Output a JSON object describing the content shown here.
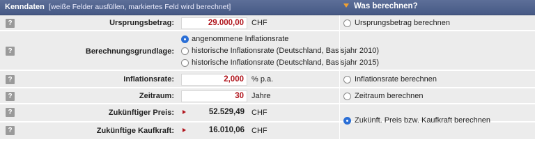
{
  "header": {
    "title": "Kenndaten",
    "subtitle": "[weiße Felder ausfüllen, markiertes Feld wird berechnet]",
    "right_title": "Was berechnen?"
  },
  "help_label": "?",
  "rows": {
    "ursprungsbetrag": {
      "label": "Ursprungsbetrag:",
      "value": "29.000,00",
      "unit": "CHF",
      "calc_option": "Ursprungsbetrag berechnen"
    },
    "berechnungsgrundlage": {
      "label": "Berechnungsgrundlage:",
      "options": [
        "angenommene Inflationsrate",
        "historische Inflationsrate (Deutschland, Basisjahr 2010)",
        "historische Inflationsrate (Deutschland, Basisjahr 2015)"
      ],
      "selected": "angenommene Inflationsrate"
    },
    "inflationsrate": {
      "label": "Inflationsrate:",
      "value": "2,000",
      "unit": "% p.a.",
      "calc_option": "Inflationsrate berechnen"
    },
    "zeitraum": {
      "label": "Zeitraum:",
      "value": "30",
      "unit": "Jahre",
      "calc_option": "Zeitraum berechnen"
    },
    "zukuenftiger_preis": {
      "label": "Zukünftiger Preis:",
      "value": "52.529,49",
      "unit": "CHF"
    },
    "zukuenftige_kaufkraft": {
      "label": "Zukünftige Kaufkraft:",
      "value": "16.010,06",
      "unit": "CHF"
    },
    "calc_selected": "Zukünft. Preis bzw. Kaufkraft berechnen"
  },
  "colors": {
    "header_bg": "#4f6290",
    "accent_orange": "#f0a030",
    "value_red": "#b0141c",
    "radio_blue": "#2b6fd6",
    "row_bg": "#ececec"
  }
}
